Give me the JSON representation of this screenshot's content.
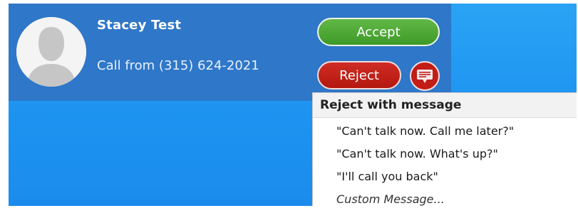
{
  "caller": {
    "name": "Stacey Test",
    "call_from": "Call from (315) 624-2021"
  },
  "actions": {
    "accept_label": "Accept",
    "reject_label": "Reject"
  },
  "reject_menu": {
    "header": "Reject with message",
    "items": [
      "\"Can't talk now. Call me later?\"",
      "\"Can't talk now. What's up?\"",
      "\"I'll call you back\""
    ],
    "custom_label": "Custom Message..."
  },
  "icons": {
    "avatar": "default-user-avatar",
    "reject_message": "message-bubble-icon"
  },
  "colors": {
    "toast_bg": "#2f77c8",
    "desktop_bg": "#1d93f0",
    "accept": "#4caa33",
    "reject": "#c21d16"
  }
}
